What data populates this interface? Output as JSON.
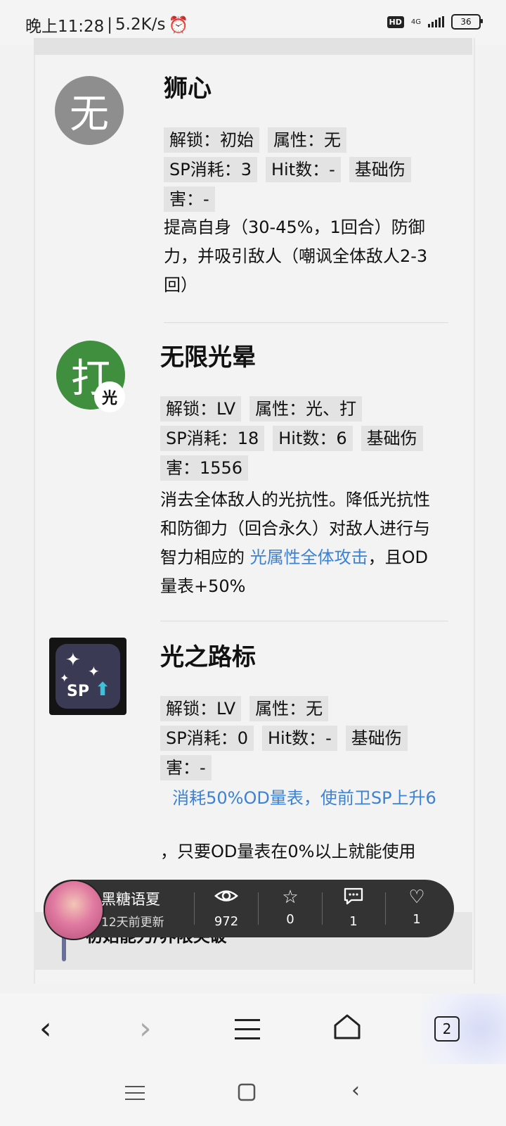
{
  "status": {
    "time": "晚上11:28",
    "speed": "5.2K/s",
    "alarm_icon": "alarm-clock-icon",
    "hd": "HD",
    "network": "4G",
    "battery": "36"
  },
  "skills": [
    {
      "icon_text": "无",
      "name": "狮心",
      "unlock": "解锁：初始",
      "attr": "属性：无",
      "sp": "SP消耗：3",
      "hit": "Hit数：-",
      "base_a": "基础伤",
      "base_b": "害：-",
      "desc": "提高自身（30-45%，1回合）防御力，并吸引敌人（嘲讽全体敌人2-3回）"
    },
    {
      "icon_text": "打",
      "icon_sub": "光",
      "name": "无限光晕",
      "unlock": "解锁：LV",
      "attr": "属性：光、打",
      "sp": "SP消耗：18",
      "hit": "Hit数：6",
      "base_a": "基础伤",
      "base_b": "害：1556",
      "desc_pre": "消去全体敌人的光抗性。降低光抗性和防御力（回合永久）对敌人进行与智力相应的",
      "desc_link": "光属性全体攻击",
      "desc_post": "，且OD量表+50%"
    },
    {
      "icon_label": "SP",
      "name": "光之路标",
      "unlock": "解锁：LV",
      "attr": "属性：无",
      "sp": "SP消耗：0",
      "hit": "Hit数：-",
      "base_a": "基础伤",
      "base_b": "害：-",
      "desc_link": "消耗50%OD量表，使前卫SP上升6",
      "desc_post": "，只要OD量表在0%以上就能使用"
    }
  ],
  "author": {
    "name": "黑糖语夏",
    "updated": "12天前更新"
  },
  "stats": {
    "views": "972",
    "favorites": "0",
    "comments": "1",
    "likes": "1"
  },
  "section": {
    "title": "初始能力/界限突破"
  },
  "browser": {
    "tab_count": "2"
  }
}
